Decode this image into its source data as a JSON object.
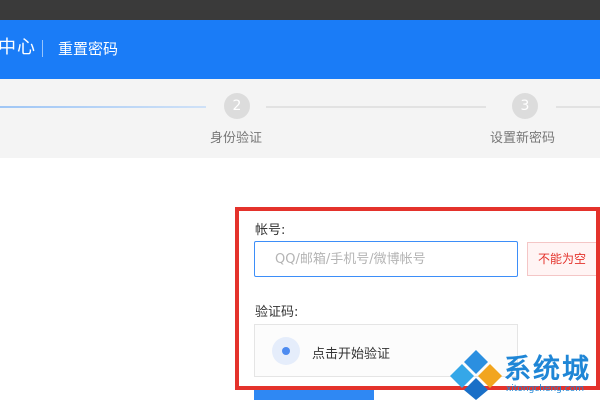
{
  "header": {
    "brand": "中心",
    "title": "重置密码"
  },
  "steps": [
    {
      "number": "2",
      "label": "身份验证"
    },
    {
      "number": "3",
      "label": "设置新密码"
    }
  ],
  "form": {
    "account_label": "帐号:",
    "account_placeholder": "QQ/邮箱/手机号/微博帐号",
    "account_value": "",
    "account_error": "不能为空",
    "captcha_label": "验证码:",
    "captcha_button": "点击开始验证"
  },
  "watermark": {
    "text": "系统城",
    "url": "xitongcheng.com"
  },
  "colors": {
    "header_blue": "#1a7cf7",
    "highlight_red": "#e4322b",
    "error_red": "#e4322b",
    "input_focus": "#3d8ef8"
  }
}
